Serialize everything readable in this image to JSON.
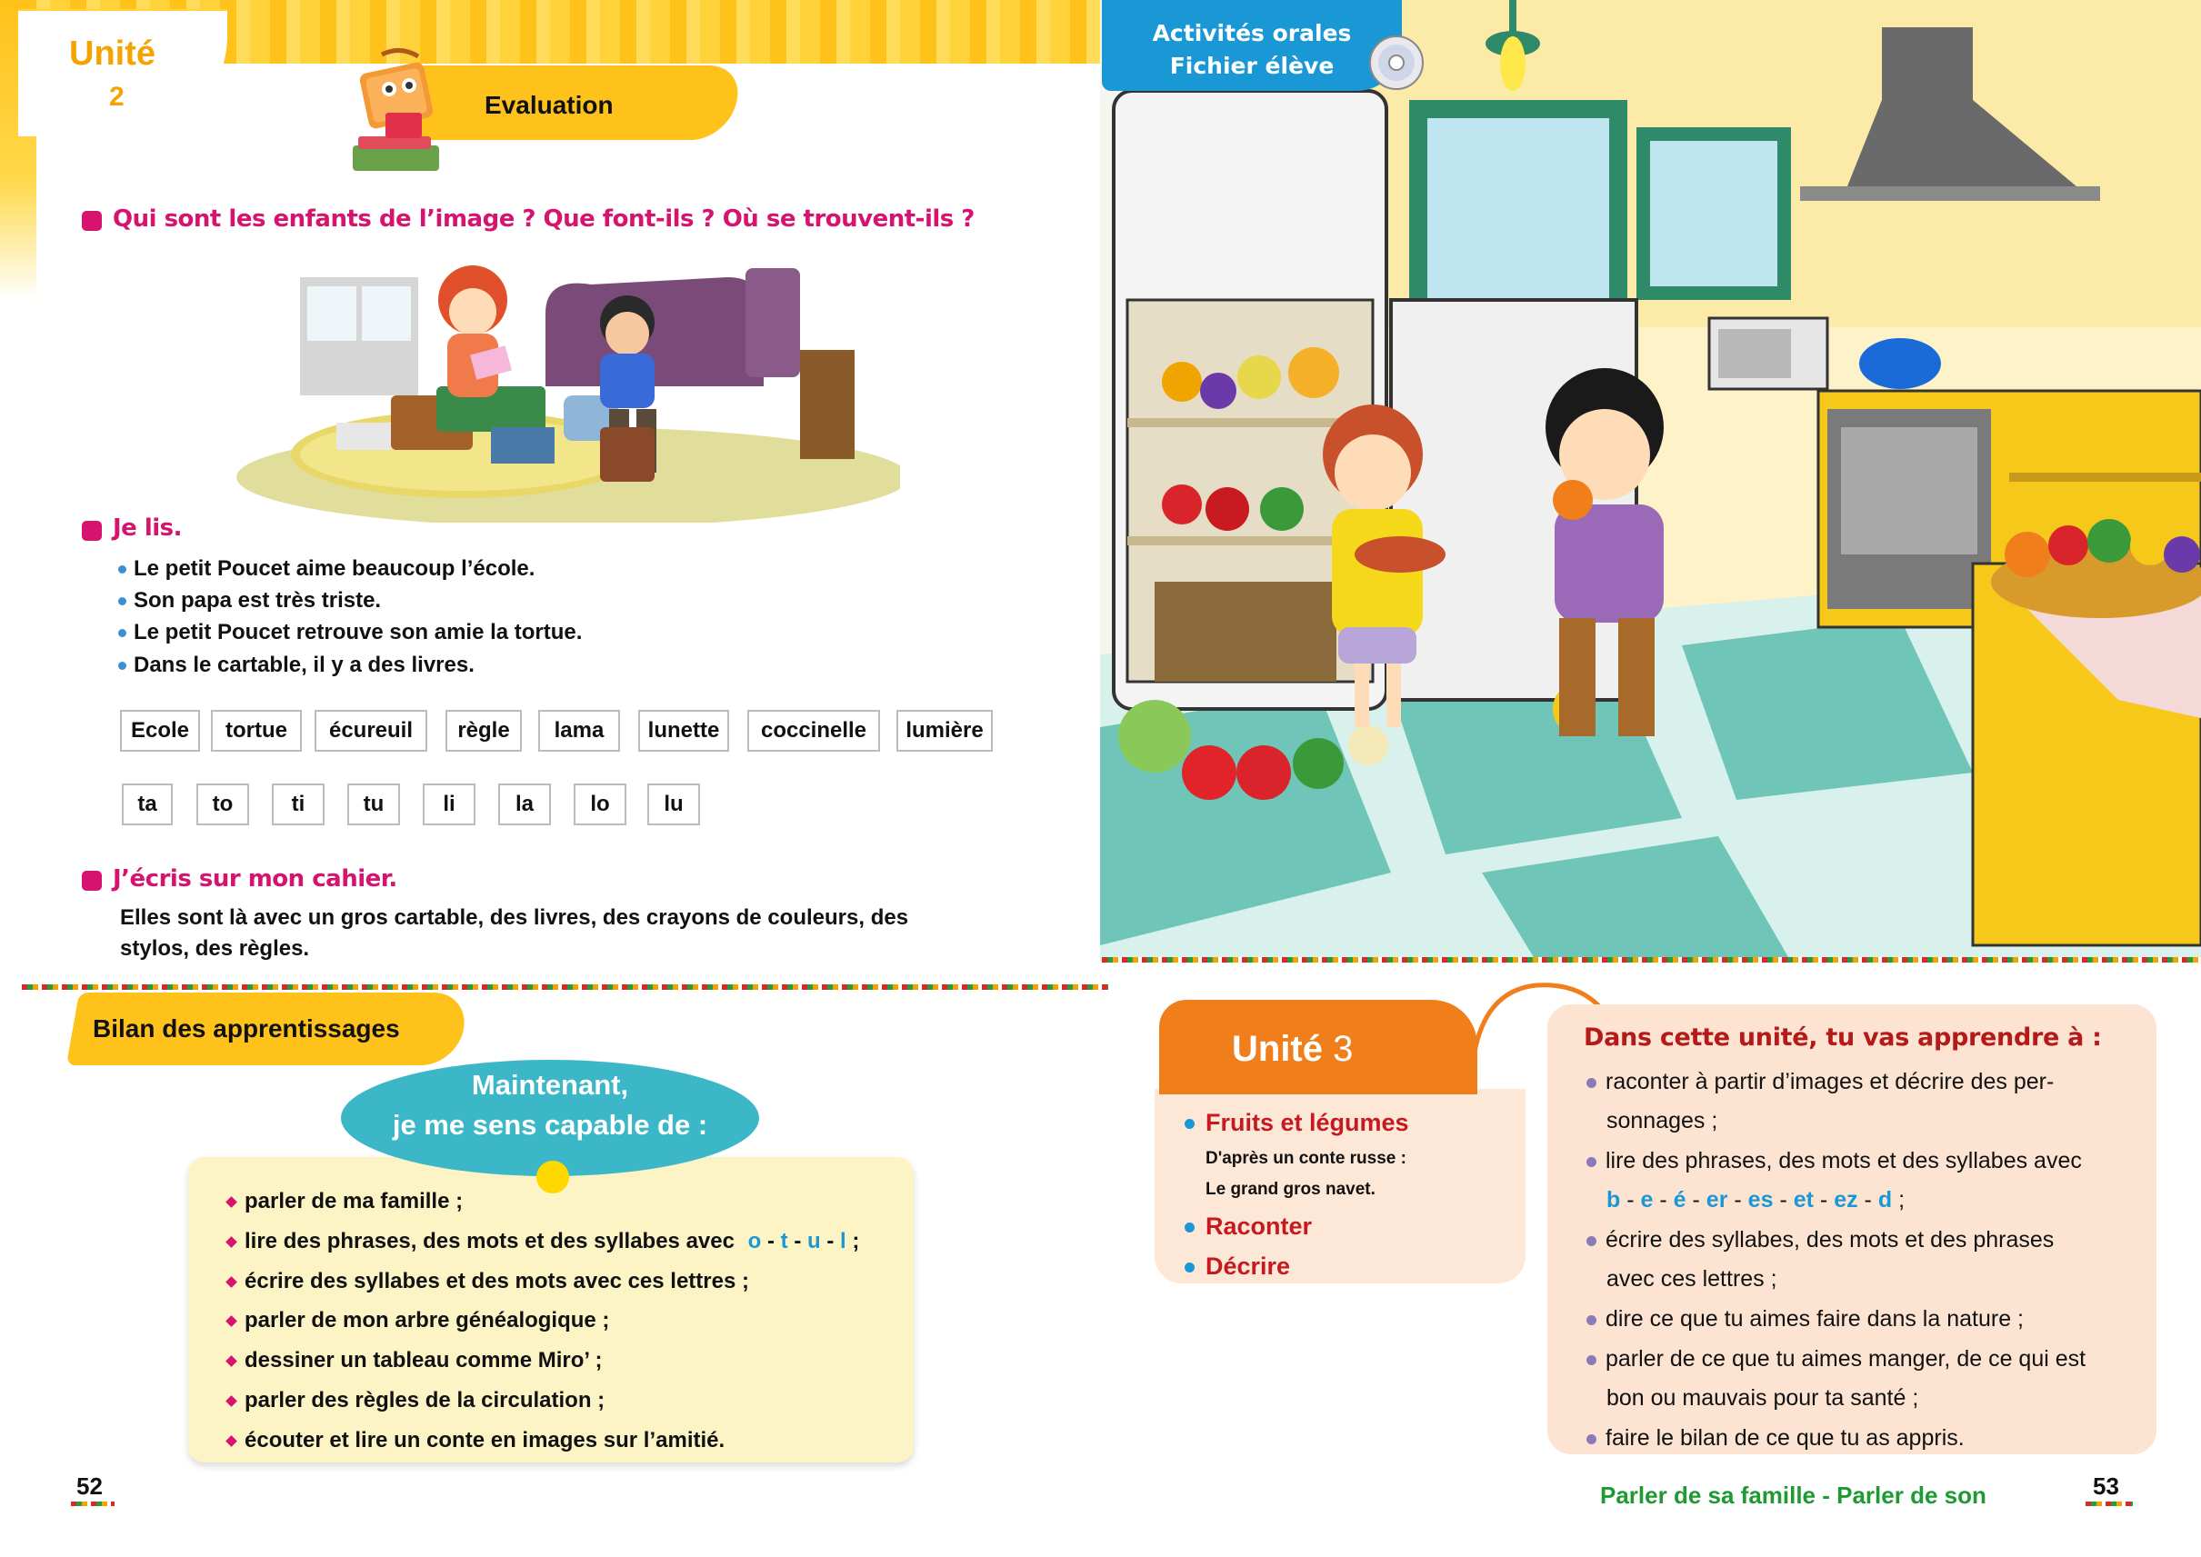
{
  "left_page": {
    "unit_tab": {
      "title": "Unité",
      "number": "2"
    },
    "evaluation_label": "Evaluation",
    "question_heading": "Qui sont les enfants de l’image ? Que font-ils ? Où se trouvent-ils ?",
    "reading": {
      "heading": "Je lis.",
      "sentences": [
        "Le petit Poucet aime beaucoup l’école.",
        "Son papa est très triste.",
        "Le petit Poucet retrouve son amie la tortue.",
        "Dans le cartable, il y a des livres."
      ],
      "words": [
        "Ecole",
        "tortue",
        "écureuil",
        "règle",
        "lama",
        "lunette",
        "coccinelle",
        "lumière"
      ],
      "syllables": [
        "ta",
        "to",
        "ti",
        "tu",
        "li",
        "la",
        "lo",
        "lu"
      ]
    },
    "writing": {
      "heading": "J’écris sur mon cahier.",
      "line1": "Elles sont là avec un gros cartable, des livres, des crayons de couleurs, des",
      "line2": "stylos, des règles."
    },
    "bilan": {
      "title": "Bilan des apprentissages",
      "bubble_line1": "Maintenant,",
      "bubble_line2": "je me sens capable de :",
      "items": [
        "parler de ma famille ;",
        "lire des phrases, des mots et des syllabes avec",
        "écrire des syllabes et des mots avec ces lettres ;",
        "parler de mon arbre généalogique ;",
        "dessiner un tableau comme Miro’ ;",
        "parler des règles de la circulation ;",
        "écouter et lire un conte en images sur l’amitié."
      ],
      "letters": [
        "o",
        "t",
        "u",
        "l"
      ],
      "letter_sep": "-",
      "end_semicolon": ";"
    },
    "page_number": "52"
  },
  "right_page": {
    "activites_tab": {
      "line1": "Activités orales",
      "line2": "Fichier élève"
    },
    "unit3": {
      "title": "Unité",
      "number": "3",
      "topics": [
        "Fruits et légumes",
        "Raconter",
        "Décrire"
      ],
      "subtitle_line1": "D'après un conte russe :",
      "subtitle_line2": "Le grand gros navet."
    },
    "learn": {
      "title": "Dans cette unité, tu vas apprendre à :",
      "item1_a": "raconter à partir d’images et décrire des per-",
      "item1_b": "sonnages ;",
      "item2_a": "lire des phrases, des mots et des syllabes avec",
      "item2_letters": [
        "b",
        "e",
        "é",
        "er",
        "es",
        "et",
        "ez",
        "d"
      ],
      "item2_sep": "-",
      "item2_end": ";",
      "item3_a": "écrire des syllabes, des mots et des phrases",
      "item3_b": "avec ces lettres ;",
      "item4": "dire ce que tu aimes faire dans la nature ;",
      "item5_a": "parler de ce que tu aimes manger, de ce qui est",
      "item5_b": "bon ou mauvais pour ta santé ;",
      "item6": "faire le bilan de ce que tu as appris."
    },
    "footer": "Parler de sa famille - Parler de son",
    "page_number": "53"
  }
}
